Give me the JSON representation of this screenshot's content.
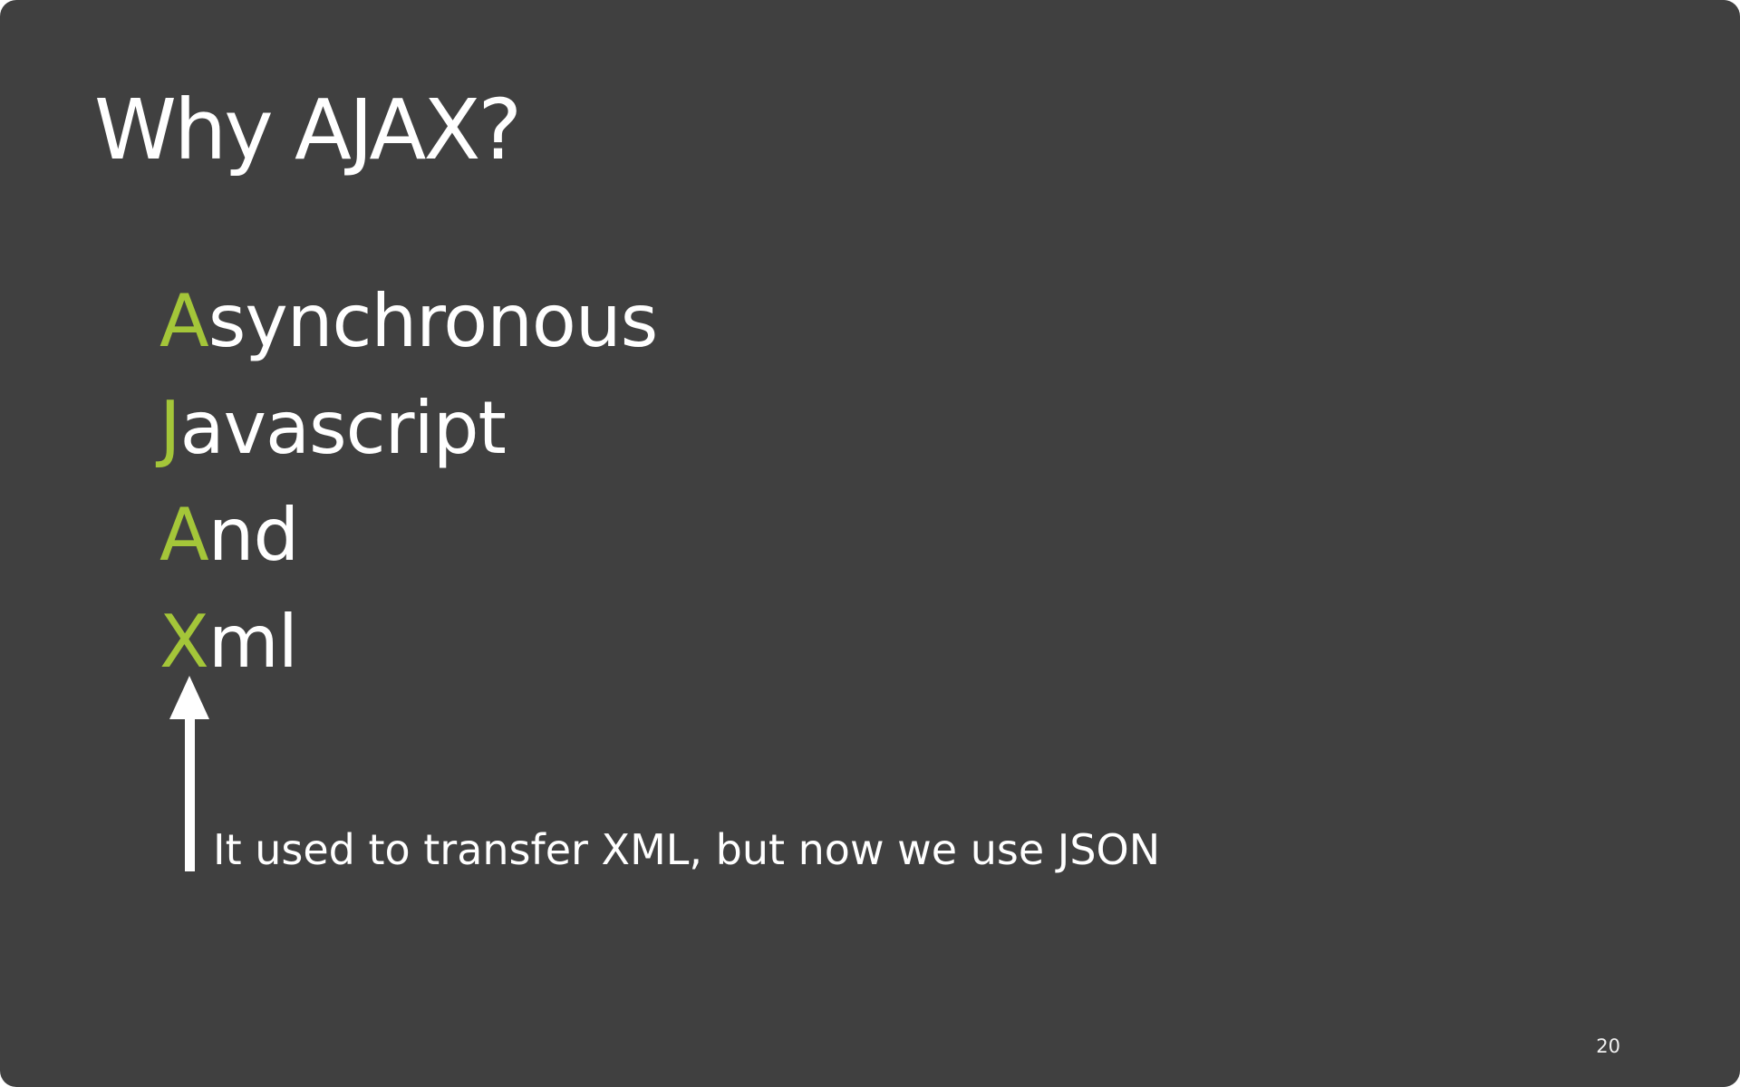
{
  "slide": {
    "title": "Why AJAX?",
    "accent_color": "#a4c639",
    "background_color": "#404040",
    "acronym": [
      {
        "initial": "A",
        "rest": "synchronous"
      },
      {
        "initial": "J",
        "rest": "avascript"
      },
      {
        "initial": "A",
        "rest": "nd"
      },
      {
        "initial": "X",
        "rest": "ml"
      }
    ],
    "note": "It used to transfer XML, but now we use JSON",
    "page_number": "20"
  }
}
